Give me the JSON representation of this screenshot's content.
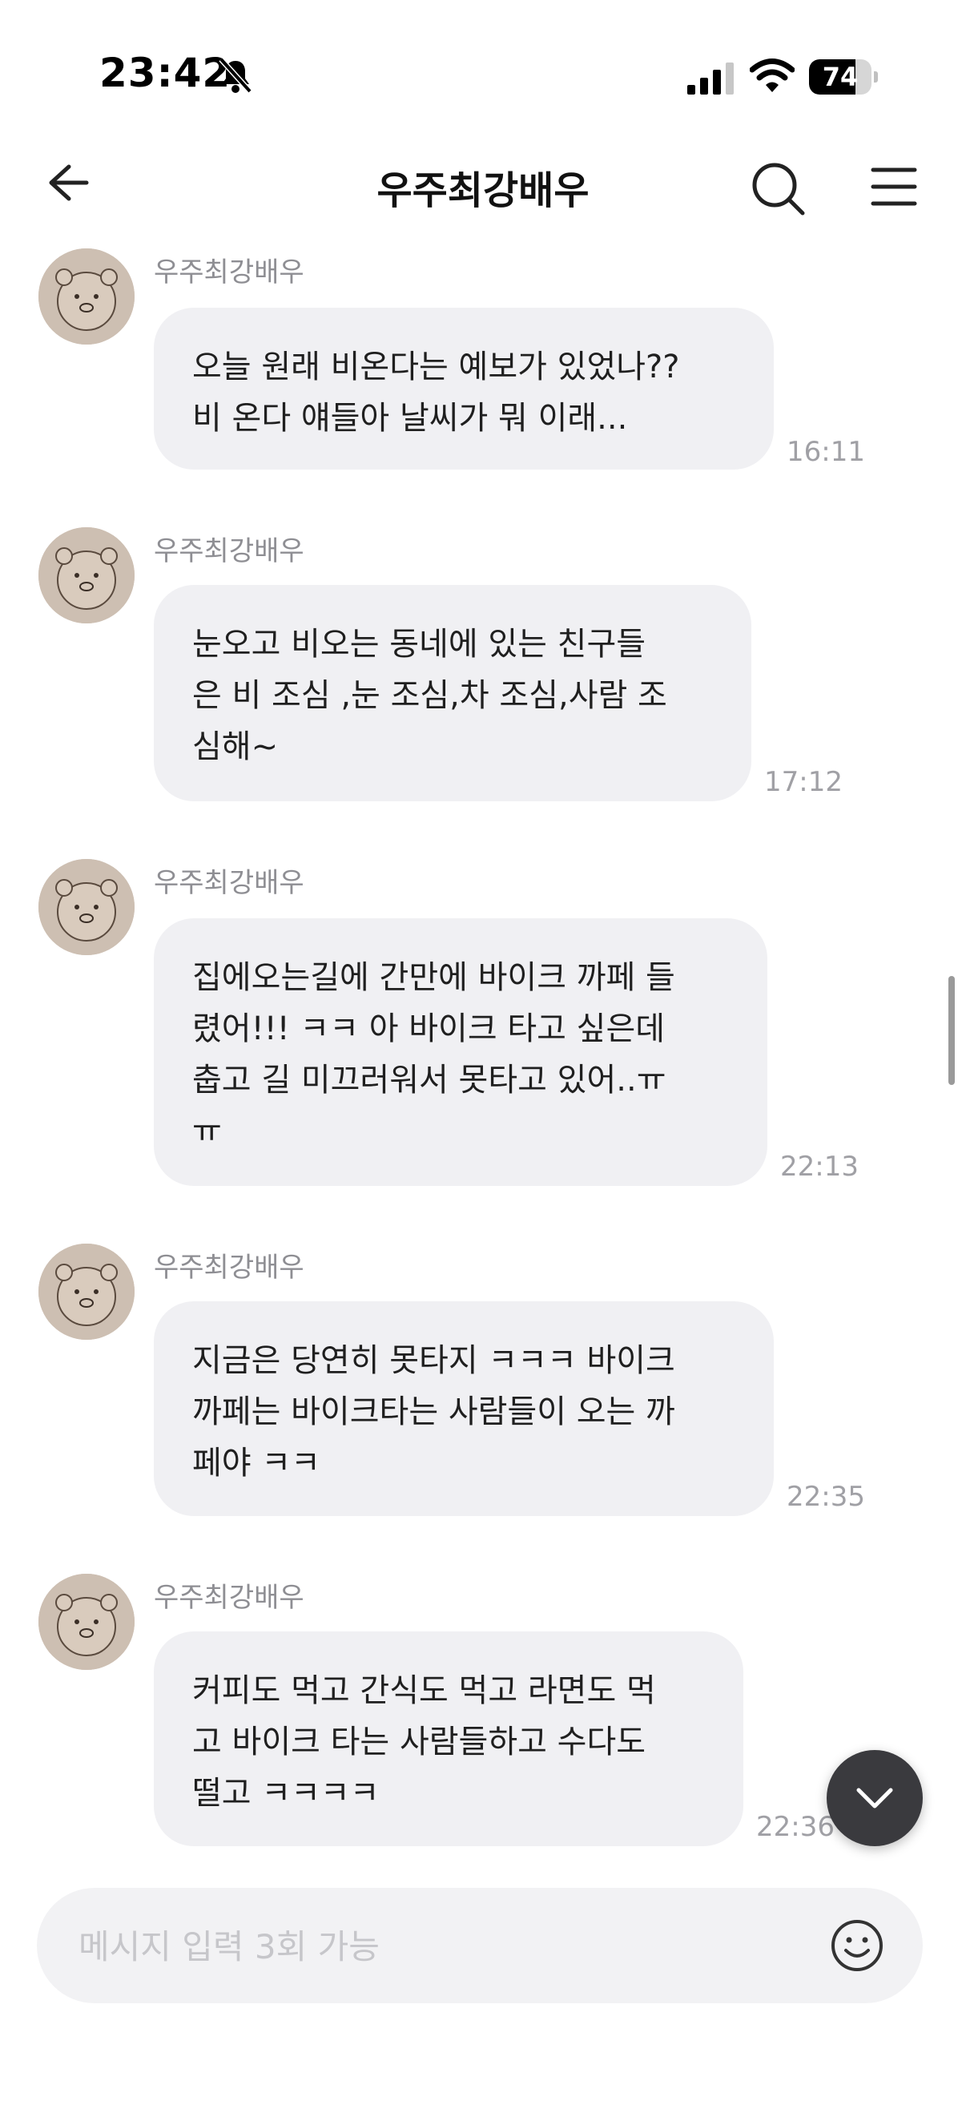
{
  "status_bar": {
    "time": "23:42",
    "battery_level": "74",
    "battery_fraction": 0.74,
    "silent_icon": "bell-slash-icon",
    "signal_icon": "cellular-signal-icon",
    "wifi_icon": "wifi-icon"
  },
  "header": {
    "title": "우주최강배우",
    "back_icon": "arrow-left-icon",
    "search_icon": "search-icon",
    "menu_icon": "hamburger-menu-icon"
  },
  "messages": [
    {
      "sender": "우주최강배우",
      "text": "오늘 원래 비온다는 예보가 있었나??\n비 온다 얘들아 날씨가 뭐 이래...",
      "time": "16:11"
    },
    {
      "sender": "우주최강배우",
      "text": "눈오고  비오는 동네에 있는 친구들\n은 비 조심 ,눈 조심,차 조심,사람 조\n심해~",
      "time": "17:12"
    },
    {
      "sender": "우주최강배우",
      "text": "집에오는길에 간만에 바이크 까페 들\n렸어!!! ㅋㅋ 아 바이크 타고 싶은데\n춥고 길 미끄러워서 못타고 있어..ㅠ\nㅠ",
      "time": "22:13"
    },
    {
      "sender": "우주최강배우",
      "text": "지금은 당연히 못타지 ㅋㅋㅋ 바이크\n까페는 바이크타는 사람들이 오는 까\n페야 ㅋㅋ",
      "time": "22:35"
    },
    {
      "sender": "우주최강배우",
      "text": "커피도 먹고 간식도 먹고 라면도 먹\n고 바이크 타는 사람들하고 수다도\n떨고 ㅋㅋㅋㅋ",
      "time": "22:36"
    }
  ],
  "scroll_down_icon": "chevron-down-icon",
  "input": {
    "placeholder": "메시지 입력 3회 가능",
    "value": "",
    "emoji_icon": "smiley-icon"
  },
  "colors": {
    "bubble": "#f0f0f3",
    "scroll_button": "#3a3a3e",
    "input_bg": "#f2f2f4",
    "meta_text": "#8e8e93"
  }
}
